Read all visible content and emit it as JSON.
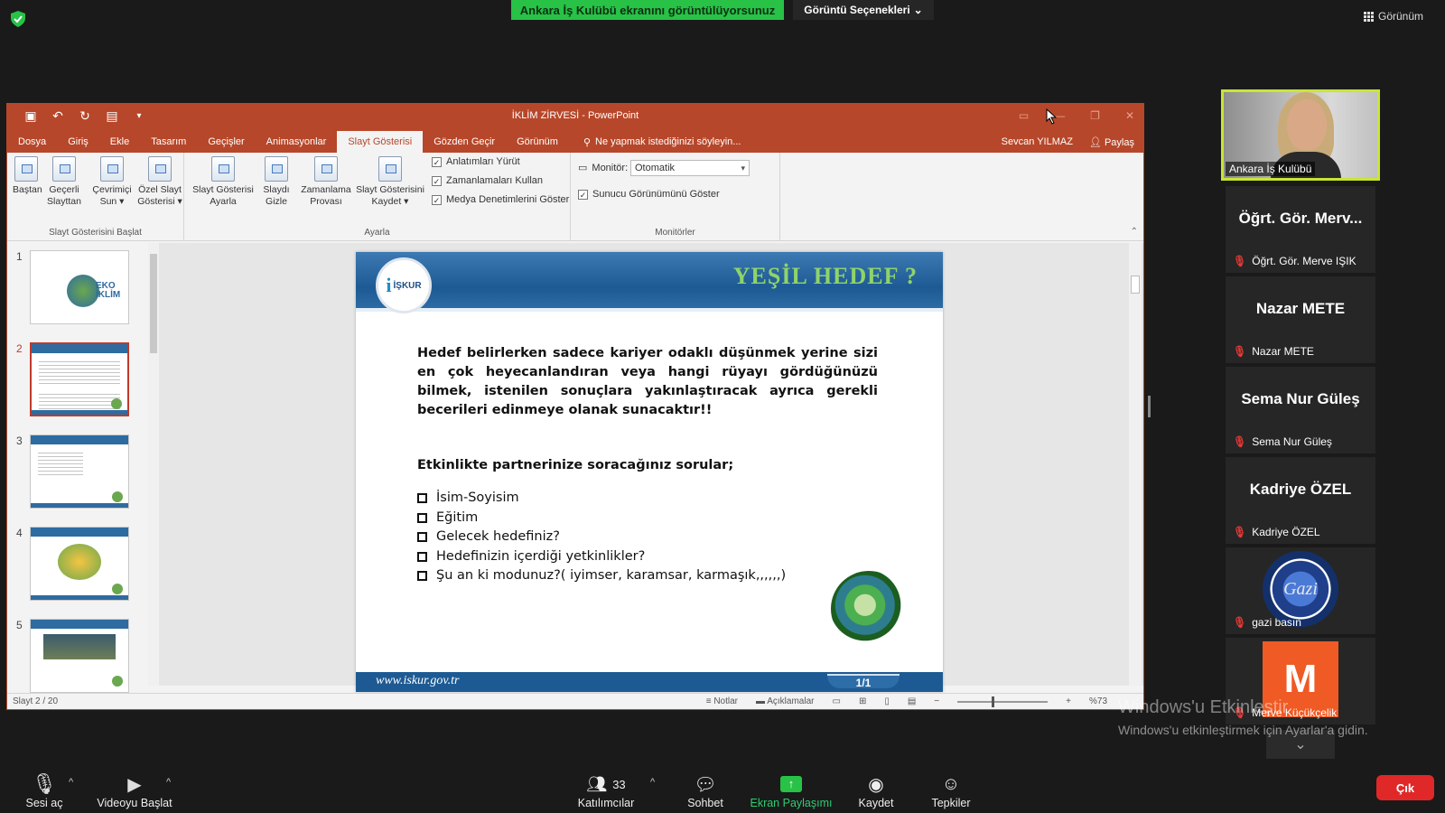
{
  "zoom": {
    "share_banner": "Ankara İş Kulübü ekranını görüntülüyorsunuz",
    "view_options": "Görüntü Seçenekleri",
    "view_toggle": "Görünüm",
    "exit": "Çık",
    "toolbar": {
      "mic": "Sesi aç",
      "video": "Videoyu Başlat",
      "participants": "Katılımcılar",
      "participants_count": "33",
      "chat": "Sohbet",
      "share": "Ekran Paylaşımı",
      "record": "Kaydet",
      "reactions": "Tepkiler"
    },
    "participants": [
      {
        "tile_name": "",
        "label": "Ankara İş Kulübü",
        "type": "video"
      },
      {
        "tile_name": "Öğrt. Gör. Merv...",
        "label": "Öğrt. Gör. Merve IŞIK",
        "type": "name"
      },
      {
        "tile_name": "Nazar METE",
        "label": "Nazar METE",
        "type": "name"
      },
      {
        "tile_name": "Sema Nur Güleş",
        "label": "Sema Nur Güleş",
        "type": "name"
      },
      {
        "tile_name": "Kadriye ÖZEL",
        "label": "Kadriye ÖZEL",
        "type": "name"
      },
      {
        "tile_name": "",
        "label": "gazi basın",
        "type": "logo"
      },
      {
        "tile_name": "M",
        "label": "Merve Küçükçelik",
        "type": "avatar"
      }
    ],
    "watermark": {
      "line1": "Windows'u Etkinleştir",
      "line2": "Windows'u etkinleştirmek için Ayarlar'a gidin."
    }
  },
  "powerpoint": {
    "title": "İKLİM ZİRVESİ - PowerPoint",
    "tabs": [
      "Dosya",
      "Giriş",
      "Ekle",
      "Tasarım",
      "Geçişler",
      "Animasyonlar",
      "Slayt Gösterisi",
      "Gözden Geçir",
      "Görünüm"
    ],
    "active_tab": "Slayt Gösterisi",
    "tell_me": "Ne yapmak istediğinizi söyleyin...",
    "user": "Sevcan YILMAZ",
    "share": "Paylaş",
    "ribbon": {
      "group1_label": "Slayt Gösterisini Başlat",
      "group2_label": "Ayarla",
      "group3_label": "Monitörler",
      "buttons": [
        "Baştan",
        "Geçerli Slayttan",
        "Çevrimiçi Sun ▾",
        "Özel Slayt Gösterisi ▾",
        "Slayt Gösterisi Ayarla",
        "Slaydı Gizle",
        "Zamanlama Provası",
        "Slayt Gösterisini Kaydet ▾"
      ],
      "checks": [
        "Anlatımları Yürüt",
        "Zamanlamaları Kullan",
        "Medya Denetimlerini Göster"
      ],
      "monitor_label": "Monitör:",
      "monitor_value": "Otomatik",
      "presenter_view": "Sunucu Görünümünü Göster"
    },
    "thumbnails": [
      {
        "num": "1"
      },
      {
        "num": "2",
        "active": true
      },
      {
        "num": "3"
      },
      {
        "num": "4"
      },
      {
        "num": "5"
      }
    ],
    "slide": {
      "title": "YEŞİL HEDEF ?",
      "logo_text": "İŞKUR",
      "paragraph": "Hedef belirlerken sadece kariyer odaklı düşünmek yerine sizi en çok heyecanlandıran veya hangi rüyayı gördüğünüzü bilmek, istenilen sonuçlara yakınlaştıracak ayrıca gerekli becerileri edinmeye olanak sunacaktır!!",
      "subheading": "Etkinlikte partnerinize  soracağınız sorular;",
      "questions": [
        "İsim-Soyisim",
        "Eğitim",
        "Gelecek hedefiniz?",
        "Hedefinizin içerdiği yetkinlikler?",
        "Şu an ki modunuz?( iyimser, karamsar, karmaşık,,,,,,)"
      ],
      "footer_url": "www.iskur.gov.tr",
      "page": "1/1"
    },
    "status": {
      "slide_count": "Slayt 2 / 20",
      "notes": "Notlar",
      "comments": "Açıklamalar",
      "zoom": "%73"
    }
  }
}
